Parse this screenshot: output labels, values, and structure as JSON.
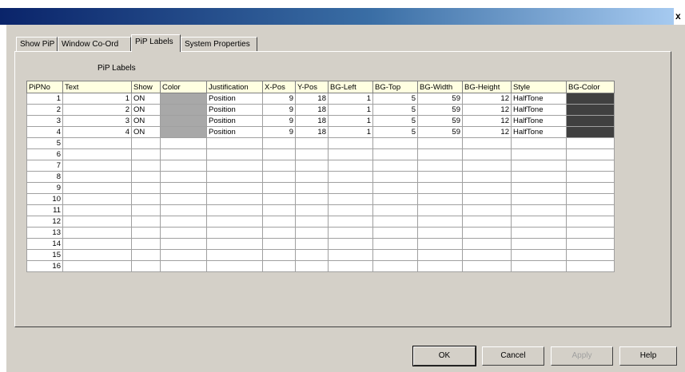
{
  "window": {
    "close_glyph": "x"
  },
  "tabs": [
    {
      "label": "Show PiP"
    },
    {
      "label": "Window Co-Ord"
    },
    {
      "label": "PiP Labels"
    },
    {
      "label": "System Properties"
    }
  ],
  "group_label": "PiP Labels",
  "columns": [
    "PiPNo",
    "Text",
    "Show",
    "Color",
    "Justification",
    "X-Pos",
    "Y-Pos",
    "BG-Left",
    "BG-Top",
    "BG-Width",
    "BG-Height",
    "Style",
    "BG-Color"
  ],
  "rows": [
    {
      "pipno": "1",
      "text": "1",
      "show": "ON",
      "justification": "Position",
      "xpos": "9",
      "ypos": "18",
      "bgleft": "1",
      "bgtop": "5",
      "bgwidth": "59",
      "bgheight": "12",
      "style": "HalfTone",
      "filled": true
    },
    {
      "pipno": "2",
      "text": "2",
      "show": "ON",
      "justification": "Position",
      "xpos": "9",
      "ypos": "18",
      "bgleft": "1",
      "bgtop": "5",
      "bgwidth": "59",
      "bgheight": "12",
      "style": "HalfTone",
      "filled": true
    },
    {
      "pipno": "3",
      "text": "3",
      "show": "ON",
      "justification": "Position",
      "xpos": "9",
      "ypos": "18",
      "bgleft": "1",
      "bgtop": "5",
      "bgwidth": "59",
      "bgheight": "12",
      "style": "HalfTone",
      "filled": true
    },
    {
      "pipno": "4",
      "text": "4",
      "show": "ON",
      "justification": "Position",
      "xpos": "9",
      "ypos": "18",
      "bgleft": "1",
      "bgtop": "5",
      "bgwidth": "59",
      "bgheight": "12",
      "style": "HalfTone",
      "filled": true
    },
    {
      "pipno": "5",
      "filled": false
    },
    {
      "pipno": "6",
      "filled": false
    },
    {
      "pipno": "7",
      "filled": false
    },
    {
      "pipno": "8",
      "filled": false
    },
    {
      "pipno": "9",
      "filled": false
    },
    {
      "pipno": "10",
      "filled": false
    },
    {
      "pipno": "11",
      "filled": false
    },
    {
      "pipno": "12",
      "filled": false
    },
    {
      "pipno": "13",
      "filled": false
    },
    {
      "pipno": "14",
      "filled": false
    },
    {
      "pipno": "15",
      "filled": false
    },
    {
      "pipno": "16",
      "filled": false
    }
  ],
  "colors": {
    "swatch_color": "#a8a8a8",
    "swatch_bg_color": "#404040"
  },
  "buttons": {
    "ok": "OK",
    "cancel": "Cancel",
    "apply": "Apply",
    "help": "Help"
  }
}
